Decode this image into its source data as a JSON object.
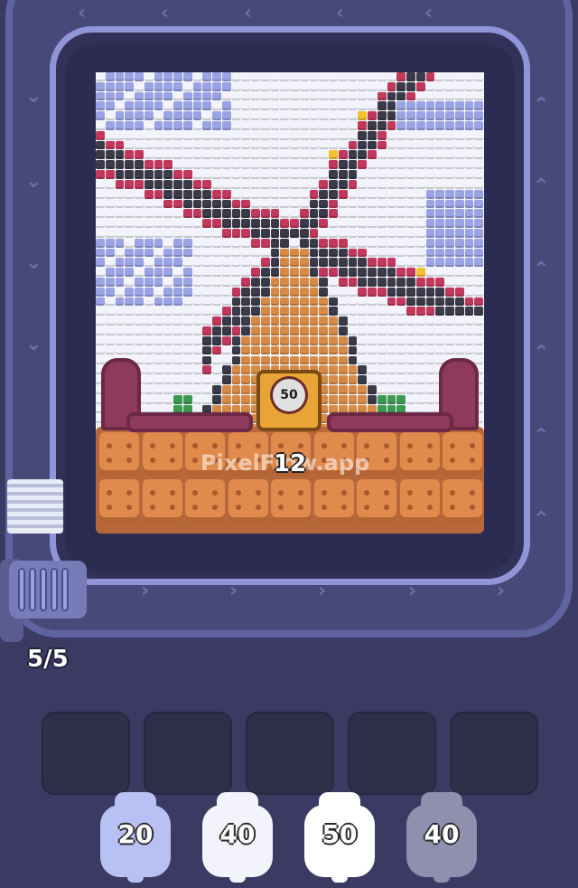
{
  "hud": {
    "title_partial": ""
  },
  "board": {
    "target_value": "50",
    "remaining_count": "12",
    "watermark": "PixelFlow.app"
  },
  "queue": {
    "ratio": "5/5",
    "slots": [
      "",
      "",
      "",
      "",
      ""
    ]
  },
  "shooters": [
    {
      "value": "20",
      "color": "#b9c0f4"
    },
    {
      "value": "40",
      "color": "#f3f4fb"
    },
    {
      "value": "50",
      "color": "#ffffff"
    },
    {
      "value": "40",
      "color": "#8f8fae"
    }
  ],
  "colors": {
    "sky": "#f3f4fb",
    "cloud": "#9aa3e3",
    "dark": "#3a3a48",
    "blade": "#c2385c",
    "accent": "#f2c230",
    "tower": "#d78a45",
    "grass": "#3c9a50"
  }
}
